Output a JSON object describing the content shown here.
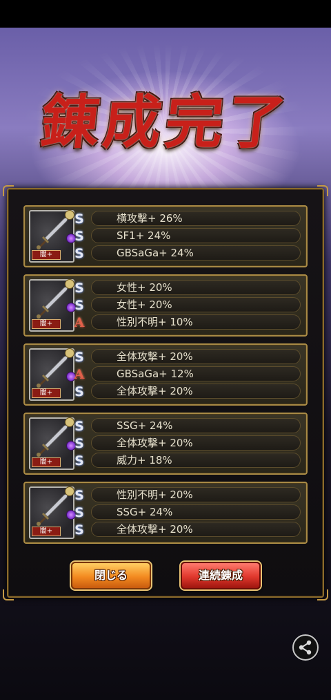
{
  "title": "錬成完了",
  "cards": [
    {
      "weapon_label": "闇+",
      "rows": [
        {
          "icon": "S",
          "text": "横攻撃+ 26%"
        },
        {
          "icon": "S",
          "text": "SF1+ 24%"
        },
        {
          "icon": "S",
          "text": "GBSaGa+ 24%"
        }
      ]
    },
    {
      "weapon_label": "闇+",
      "rows": [
        {
          "icon": "S",
          "text": "女性+ 20%"
        },
        {
          "icon": "S",
          "text": "女性+ 20%"
        },
        {
          "icon": "A",
          "text": "性別不明+ 10%"
        }
      ]
    },
    {
      "weapon_label": "闇+",
      "rows": [
        {
          "icon": "S",
          "text": "全体攻撃+ 20%"
        },
        {
          "icon": "A",
          "text": "GBSaGa+ 12%"
        },
        {
          "icon": "S",
          "text": "全体攻撃+ 20%"
        }
      ]
    },
    {
      "weapon_label": "闇+",
      "rows": [
        {
          "icon": "S",
          "text": "SSG+ 24%"
        },
        {
          "icon": "S",
          "text": "全体攻撃+ 20%"
        },
        {
          "icon": "S",
          "text": "威力+ 18%"
        }
      ]
    },
    {
      "weapon_label": "闇+",
      "rows": [
        {
          "icon": "S",
          "text": "性別不明+ 20%"
        },
        {
          "icon": "S",
          "text": "SSG+ 24%"
        },
        {
          "icon": "S",
          "text": "全体攻撃+ 20%"
        }
      ]
    }
  ],
  "buttons": {
    "close": "閉じる",
    "continue": "連続錬成"
  },
  "icons": {
    "weapon": "sword-icon",
    "share": "share-icon"
  }
}
